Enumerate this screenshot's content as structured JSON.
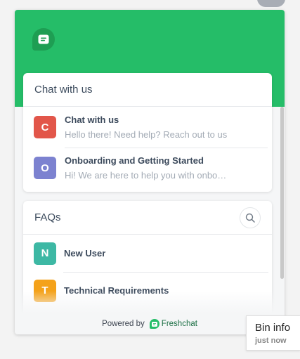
{
  "chat_card": {
    "title": "Chat with us",
    "conversations": [
      {
        "initial": "C",
        "name": "Chat with us",
        "preview": "Hello there! Need help? Reach out to us",
        "color": "#e2564a"
      },
      {
        "initial": "O",
        "name": "Onboarding and Getting Started",
        "preview": "Hi! We are here to help you with onboarding",
        "color": "#7c82d0"
      }
    ]
  },
  "faq_card": {
    "title": "FAQs",
    "items": [
      {
        "initial": "N",
        "label": "New User",
        "color": "#3db8a4"
      },
      {
        "initial": "T",
        "label": "Technical Requirements",
        "color": "#f4a21a"
      }
    ]
  },
  "footer": {
    "powered_by": "Powered by",
    "brand": "Freshchat"
  },
  "notification": {
    "title": "Bin info",
    "time": "just now"
  },
  "colors": {
    "header": "#25bd68",
    "brand_badge": "#1e9e53"
  },
  "icons": {
    "brand": "chat-bubble-icon",
    "search": "search-icon",
    "footer_logo": "freshchat-logo-icon"
  }
}
